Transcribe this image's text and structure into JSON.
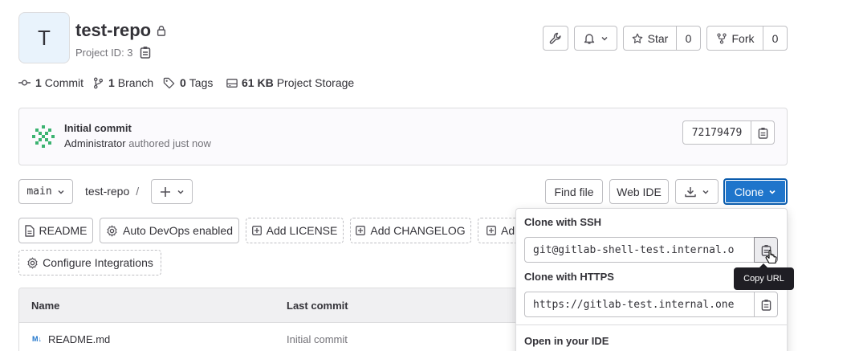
{
  "project": {
    "avatar_letter": "T",
    "name": "test-repo",
    "id_label": "Project ID: 3"
  },
  "header_actions": {
    "star_label": "Star",
    "star_count": "0",
    "fork_label": "Fork",
    "fork_count": "0"
  },
  "stats": {
    "commits_count": "1",
    "commits_label": "Commit",
    "branches_count": "1",
    "branches_label": "Branch",
    "tags_count": "0",
    "tags_label": "Tags",
    "storage_size": "61 KB",
    "storage_label": "Project Storage"
  },
  "last_commit": {
    "title": "Initial commit",
    "author": "Administrator",
    "meta": "authored just now",
    "sha": "72179479"
  },
  "repo_nav": {
    "branch": "main",
    "path": "test-repo",
    "separator": "/",
    "find_file": "Find file",
    "web_ide": "Web IDE",
    "clone": "Clone"
  },
  "shortcuts": {
    "readme": "README",
    "auto_devops": "Auto DevOps enabled",
    "add_license": "Add LICENSE",
    "add_changelog": "Add CHANGELOG",
    "add_partial": "Ad",
    "configure_integrations": "Configure Integrations"
  },
  "file_table": {
    "headers": [
      "Name",
      "Last commit"
    ],
    "rows": [
      {
        "name": "README.md",
        "commit": "Initial commit"
      }
    ]
  },
  "clone_dropdown": {
    "ssh_label": "Clone with SSH",
    "ssh_url": "git@gitlab-shell-test.internal.o",
    "https_label": "Clone with HTTPS",
    "https_url": "https://gitlab-test.internal.one",
    "ide_label": "Open in your IDE",
    "tooltip": "Copy URL"
  },
  "colors": {
    "primary": "#1f75cb",
    "avatar_bg": "#e9f3fc",
    "border": "#dcdcde",
    "muted": "#737278"
  }
}
